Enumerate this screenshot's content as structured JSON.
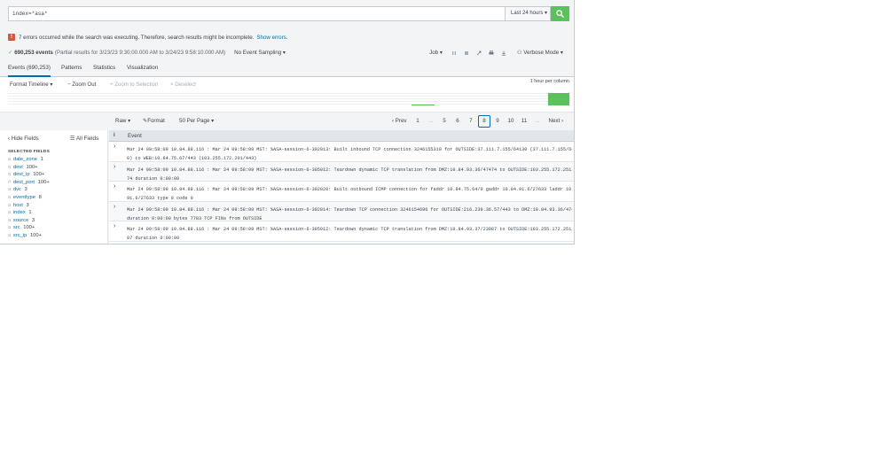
{
  "search": {
    "query": "index=*asa*",
    "time_range": "Last 24 hours",
    "search_icon": "magnifier-icon"
  },
  "errors": {
    "count": "!",
    "message": "7 errors occurred while the search was executing. Therefore, search results might be incomplete.",
    "link": "Show errors."
  },
  "job": {
    "events_count": "690,253 events",
    "partial": "(Partial results for 3/23/23 9:30:00.000 AM to 3/24/23 9:58:10.000 AM)",
    "sampling": "No Event Sampling",
    "job_label": "Job",
    "mode": "Verbose Mode"
  },
  "tabs": [
    {
      "label": "Events (690,253)"
    },
    {
      "label": "Patterns"
    },
    {
      "label": "Statistics"
    },
    {
      "label": "Visualization"
    }
  ],
  "timeline": {
    "format": "Format Timeline",
    "zoom_out": "Zoom Out",
    "zoom_selection": "+ Zoom to Selection",
    "deselect": "× Deselect",
    "scale": "1 hour per column"
  },
  "controls": {
    "view": "Raw",
    "format": "Format",
    "per_page": "50 Per Page",
    "prev": "Prev",
    "next": "Next",
    "pages": [
      "1",
      "...",
      "5",
      "6",
      "7",
      "8",
      "9",
      "10",
      "11",
      "..."
    ],
    "active_page": "8"
  },
  "sidebar": {
    "hide_fields": "Hide Fields",
    "all_fields": "All Fields",
    "selected_heading": "SELECTED FIELDS",
    "fields": [
      {
        "type": "a",
        "name": "date_zone",
        "count": "1"
      },
      {
        "type": "a",
        "name": "dest",
        "count": "100+"
      },
      {
        "type": "a",
        "name": "dest_ip",
        "count": "100+"
      },
      {
        "type": "#",
        "name": "dest_port",
        "count": "100+"
      },
      {
        "type": "a",
        "name": "dvc",
        "count": "3"
      },
      {
        "type": "a",
        "name": "eventtype",
        "count": "8"
      },
      {
        "type": "a",
        "name": "host",
        "count": "3"
      },
      {
        "type": "a",
        "name": "index",
        "count": "1"
      },
      {
        "type": "a",
        "name": "source",
        "count": "3"
      },
      {
        "type": "a",
        "name": "src",
        "count": "100+"
      },
      {
        "type": "a",
        "name": "src_ip",
        "count": "100+"
      }
    ]
  },
  "events": {
    "info_icon": "i",
    "column": "Event",
    "rows": [
      {
        "line1": "Mar 24 09:58:09 10.84.88.116 : Mar 24 09:58:09 MST: %ASA-session-6-302013: Built inbound TCP connection 3246155310 for OUTSIDE:37.111.7.155/64130 (37.111.7.155/6413",
        "line2": "0) to WEB:10.84.75.67/443 (103.255.172.201/443)"
      },
      {
        "line1": "Mar 24 09:58:09 10.84.88.116 : Mar 24 09:58:09 MST: %ASA-session-6-305012: Teardown dynamic TCP translation from DMZ:10.84.93.36/47474 to OUTSIDE:103.255.172.251/47",
        "line2": "74 duration 0:00:00"
      },
      {
        "line1": "Mar 24 09:58:09 10.84.88.116 : Mar 24 09:58:09 MST: %ASA-session-6-302020: Built outbound ICMP connection for faddr 10.84.75.64/0 gaddr 10.84.91.6/27633 laddr 10.84",
        "line2": "91.6/27633 type 8 code 0"
      },
      {
        "line1": "Mar 24 09:58:09 10.84.88.116 : Mar 24 09:58:09 MST: %ASA-session-6-302014: Teardown TCP connection 3246154696 for OUTSIDE:216.239.36.57/443 to DMZ:10.84.93.36/47474",
        "line2": "duration 0:00:00 bytes 7783 TCP FINs from OUTSIDE"
      },
      {
        "line1": "Mar 24 09:58:09 10.84.88.116 : Mar 24 09:58:09 MST: %ASA-session-6-305012: Teardown dynamic TCP translation from DMZ:10.84.93.37/23087 to OUTSIDE:103.255.172.251/23",
        "line2": "87 duration 0:00:00"
      }
    ]
  },
  "colors": {
    "accent": "#006eaa",
    "success": "#5cc05c",
    "error": "#d6563c"
  }
}
